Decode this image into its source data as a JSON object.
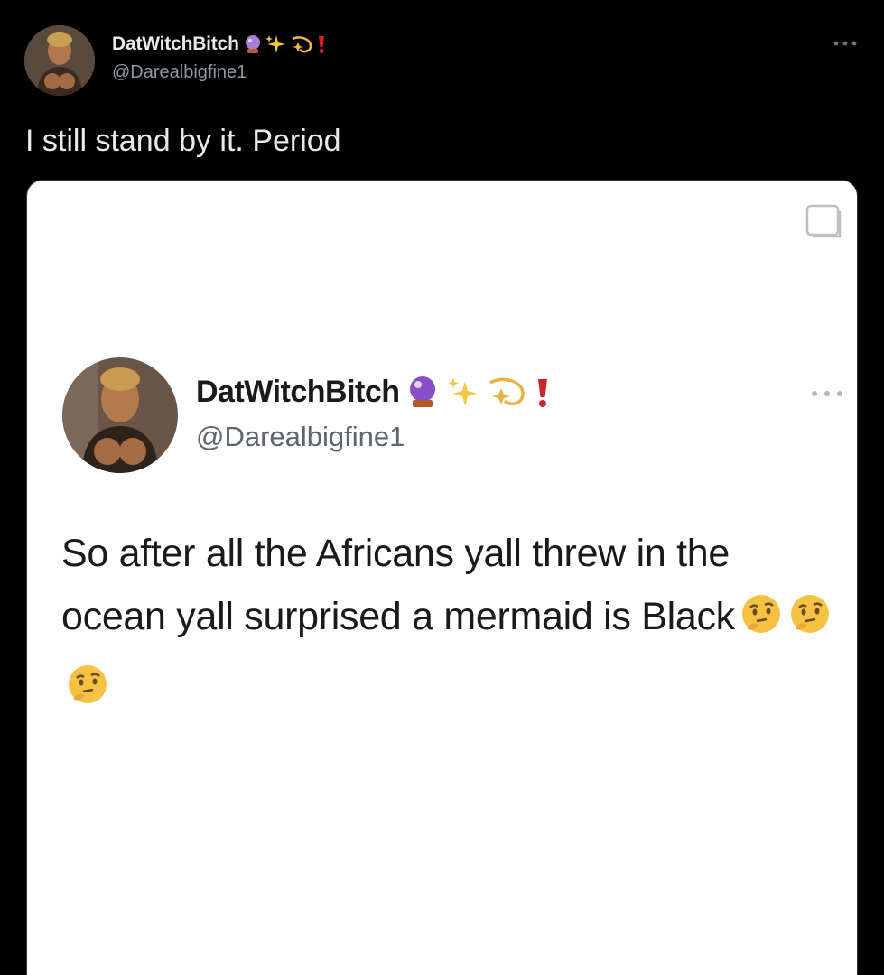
{
  "tweet": {
    "display_name": "DatWitchBitch",
    "handle": "@Darealbigfine1",
    "name_emojis": [
      "crystal-ball",
      "sparkles",
      "dizzy",
      "red-exclamation"
    ],
    "text": "I still stand by it. Period",
    "more_icon": "more-horizontal"
  },
  "quoted_image": {
    "display_name": "DatWitchBitch",
    "handle": "@Darealbigfine1",
    "name_emojis": [
      "crystal-ball",
      "sparkles",
      "dizzy",
      "red-exclamation"
    ],
    "text": "So after all the Africans yall threw in the ocean yall surprised a mermaid is Black",
    "trailing_emojis": [
      "thinking-face",
      "thinking-face",
      "thinking-face"
    ],
    "corner_icon": "copy-icon"
  },
  "colors": {
    "background": "#000000",
    "primary_text": "#e7e9ea",
    "secondary_text": "#8b98a5",
    "media_background": "#ffffff"
  }
}
